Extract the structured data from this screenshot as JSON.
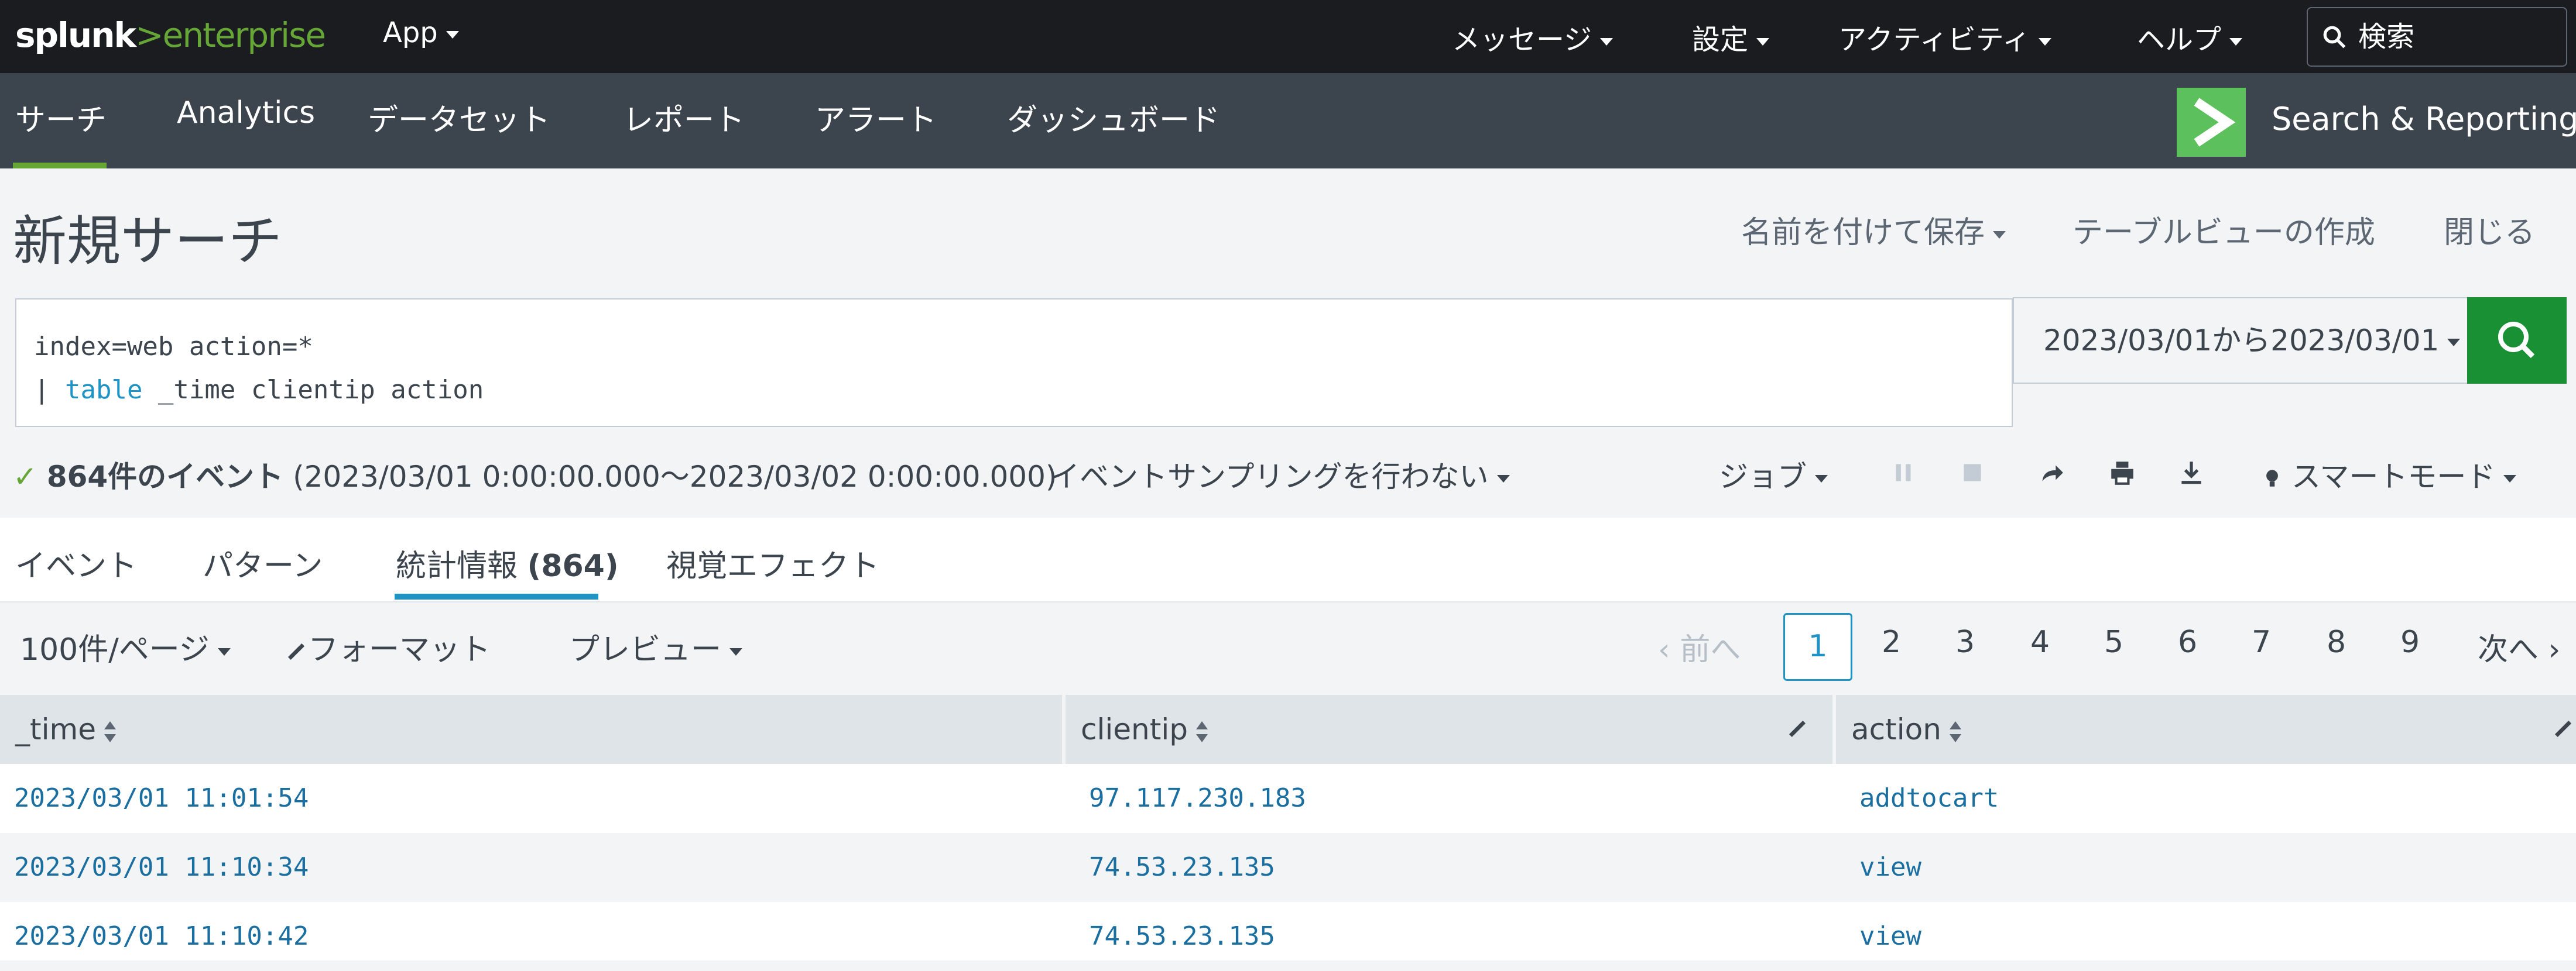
{
  "topbar": {
    "logo_brand": "splunk",
    "logo_suffix": ">enterprise",
    "app_menu": "App",
    "messages": "メッセージ",
    "settings": "設定",
    "activity": "アクティビティ",
    "help": "ヘルプ",
    "search_placeholder": "検索"
  },
  "appbar": {
    "tabs": [
      "サーチ",
      "Analytics",
      "データセット",
      "レポート",
      "アラート",
      "ダッシュボード"
    ],
    "active_tab": "サーチ",
    "app_title": "Search & Reporting"
  },
  "header": {
    "title": "新規サーチ",
    "save_as": "名前を付けて保存",
    "create_table_view": "テーブルビューの作成",
    "close": "閉じる"
  },
  "search": {
    "query_line1": "index=web action=*",
    "query_line2_pipe": "| ",
    "query_line2_cmd": "table",
    "query_line2_rest": " _time clientip action",
    "time_range": "2023/03/01から2023/03/01"
  },
  "status": {
    "event_count": "864件のイベント",
    "range": "(2023/03/01 0:00:00.000～2023/03/02 0:00:00.000)",
    "sampling": "イベントサンプリングを行わない",
    "job": "ジョブ",
    "mode": "スマートモード"
  },
  "tabs": {
    "events": "イベント",
    "patterns": "パターン",
    "statistics": "統計情報",
    "statistics_count": "(864)",
    "visualization": "視覚エフェクト"
  },
  "toolbar": {
    "per_page": "100件/ページ",
    "format": "フォーマット",
    "preview": "プレビュー"
  },
  "pagination": {
    "prev": "前へ",
    "current": "1",
    "pages": [
      "2",
      "3",
      "4",
      "5",
      "6",
      "7",
      "8",
      "9"
    ],
    "next": "次へ"
  },
  "table": {
    "columns": [
      "_time",
      "clientip",
      "action"
    ],
    "rows": [
      [
        "2023/03/01 11:01:54",
        "97.117.230.183",
        "addtocart"
      ],
      [
        "2023/03/01 11:10:34",
        "74.53.23.135",
        "view"
      ],
      [
        "2023/03/01 11:10:42",
        "74.53.23.135",
        "view"
      ]
    ]
  },
  "colors": {
    "topbar": "#1a1c20",
    "appbar": "#3c444d",
    "accent_green": "#65a637",
    "accent_blue": "#1e93c6",
    "go_button": "#1a9035"
  },
  "icons": {
    "search": "search-icon",
    "check": "check-icon",
    "pause": "pause-icon",
    "stop": "stop-icon",
    "share": "share-icon",
    "print": "print-icon",
    "export": "download-icon",
    "mode": "bulb-icon",
    "format": "pencil-icon"
  }
}
